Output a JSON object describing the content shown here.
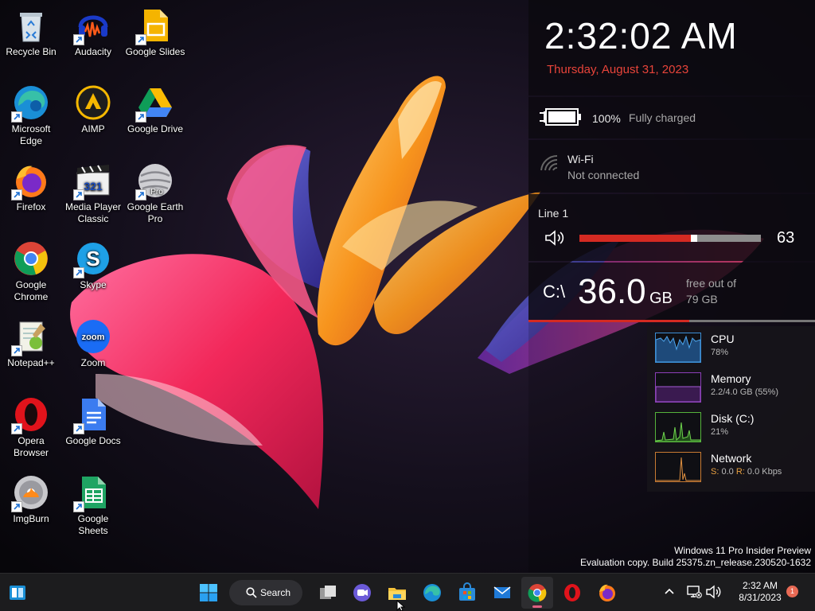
{
  "desktop": {
    "icons": [
      {
        "label": "Recycle Bin"
      },
      {
        "label": "Audacity"
      },
      {
        "label": "Google Slides"
      },
      {
        "label": "Microsoft Edge"
      },
      {
        "label": "AIMP"
      },
      {
        "label": "Google Drive"
      },
      {
        "label": "Firefox"
      },
      {
        "label": "Media Player Classic"
      },
      {
        "label": "Google Earth Pro"
      },
      {
        "label": "Google Chrome"
      },
      {
        "label": "Skype"
      },
      {
        "label": "Notepad++"
      },
      {
        "label": "Zoom"
      },
      {
        "label": "Opera Browser"
      },
      {
        "label": "Google Docs"
      },
      {
        "label": "ImgBurn"
      },
      {
        "label": "Google Sheets"
      }
    ],
    "icon_badges": {
      "mpc": "321",
      "earth": "Pro",
      "zoom": "zoom"
    }
  },
  "clock": {
    "time": "2:32:02 AM",
    "date": "Thursday, August 31, 2023"
  },
  "battery": {
    "percent": "100%",
    "status": "Fully charged"
  },
  "wifi": {
    "label": "Wi-Fi",
    "status": "Not connected"
  },
  "volume": {
    "device": "Line 1",
    "value": "63",
    "level": 0.63
  },
  "disk_free": {
    "drive": "C:\\",
    "amount": "36.0",
    "unit": "GB",
    "text1": "free out of",
    "text2": "79 GB"
  },
  "performance": [
    {
      "name": "CPU",
      "value": "78%",
      "color": "#3b8fd6"
    },
    {
      "name": "Memory",
      "value": "2.2/4.0 GB (55%)",
      "color": "#8c3fb8"
    },
    {
      "name": "Disk (C:)",
      "value": "21%",
      "color": "#55b33b"
    },
    {
      "name": "Network",
      "s_label": "S:",
      "s_value": "0.0",
      "r_label": "R:",
      "r_value": "0.0 Kbps",
      "color": "#c87a32"
    }
  ],
  "watermark": {
    "line1": "Windows 11 Pro Insider Preview",
    "line2": "Evaluation copy. Build 25375.zn_release.230520-1632"
  },
  "taskbar": {
    "search_label": "Search",
    "time": "2:32 AM",
    "date": "8/31/2023",
    "notification_count": "1"
  },
  "colors": {
    "accent_red": "#e8443a",
    "volume_red": "#d42a22",
    "badge": "#e86a55"
  }
}
